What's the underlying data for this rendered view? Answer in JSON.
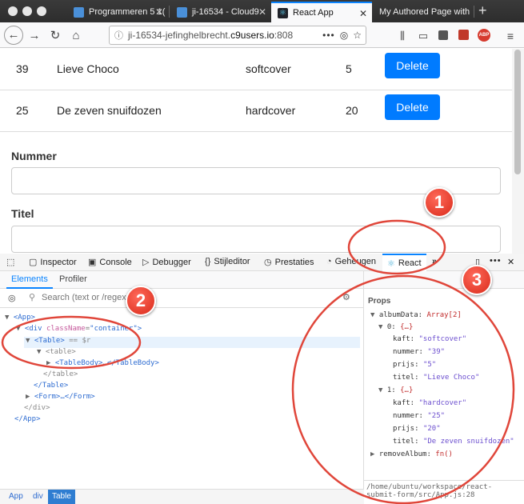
{
  "browser": {
    "tabs": [
      {
        "label": "Programmeren 5 1(",
        "active": false
      },
      {
        "label": "ji-16534 - Cloud9",
        "active": false
      },
      {
        "label": "React App",
        "active": true
      },
      {
        "label": "My Authored Page with",
        "active": false
      }
    ],
    "new_tab_label": "+",
    "url_prefix": "ji-16534-jefinghelbrecht.",
    "url_host": "c9users.io",
    "url_suffix": ":808",
    "url_more": "•••"
  },
  "table": {
    "rows": [
      {
        "nummer": "39",
        "titel": "Lieve Choco",
        "kaft": "softcover",
        "prijs": "5",
        "button": "Delete"
      },
      {
        "nummer": "25",
        "titel": "De zeven snuifdozen",
        "kaft": "hardcover",
        "prijs": "20",
        "button": "Delete"
      }
    ]
  },
  "form": {
    "nummer_label": "Nummer",
    "titel_label": "Titel"
  },
  "devtools": {
    "tabs": [
      "Inspector",
      "Console",
      "Debugger",
      "Stijleditor",
      "Prestaties",
      "Geheugen",
      "React"
    ],
    "active_tab": "React",
    "subtabs": [
      "Elements",
      "Profiler"
    ],
    "search_placeholder": "Search (text or /regex/)",
    "tree": {
      "app_open": "<App>",
      "div_open_tag": "<div",
      "div_attr_name": "className",
      "div_attr_value": "\"container\"",
      "table_open": "<Table>",
      "table_sel_suffix": "== $r",
      "table_html_open": "<table>",
      "tablebody": "<TableBody>…</TableBody>",
      "table_html_close": "</table>",
      "table_close": "</Table>",
      "form": "<Form>…</Form>",
      "div_close": "</div>",
      "app_close": "</App>"
    },
    "props": {
      "heading": "Props",
      "albumdata_key": "albumData:",
      "albumdata_type": "Array[2]",
      "items": [
        {
          "index": "0:",
          "obj": "{…}",
          "kaft": "\"softcover\"",
          "nummer": "\"39\"",
          "prijs": "\"5\"",
          "titel": "\"Lieve Choco\""
        },
        {
          "index": "1:",
          "obj": "{…}",
          "kaft": "\"hardcover\"",
          "nummer": "\"25\"",
          "prijs": "\"20\"",
          "titel": "\"De zeven snuifdozen\""
        }
      ],
      "kaft_key": "kaft:",
      "nummer_key": "nummer:",
      "prijs_key": "prijs:",
      "titel_key": "titel:",
      "remove_key": "removeAlbum:",
      "remove_val": "fn()"
    },
    "breadcrumbs": [
      "App",
      "div",
      "Table"
    ],
    "file_path": "/home/ubuntu/workspace/react-submit-form/src/App.js:28"
  },
  "annotations": [
    "1",
    "2",
    "3"
  ],
  "colors": {
    "accent": "#0a84ff",
    "delete_button": "#007bff",
    "annotation_red": "#e0463a"
  }
}
